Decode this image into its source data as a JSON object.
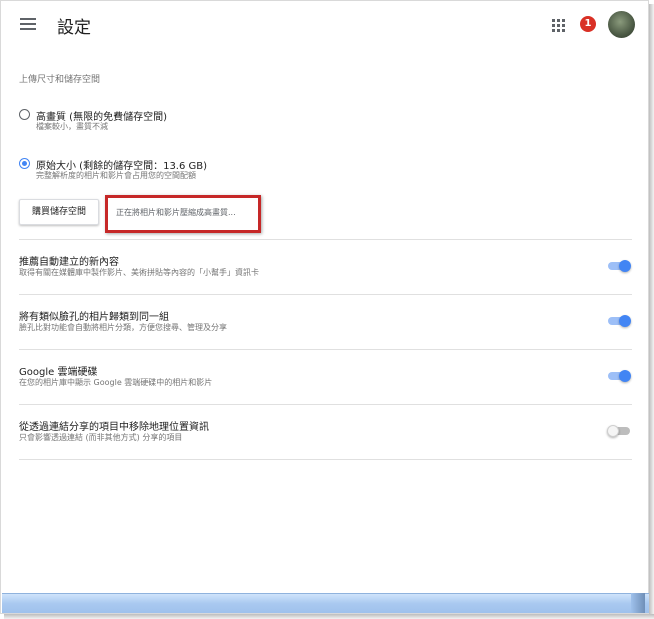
{
  "header": {
    "title": "設定",
    "notification_count": "1"
  },
  "upload": {
    "section_title": "上傳尺寸和儲存空間",
    "options": [
      {
        "label": "高畫質 (無限的免費儲存空間)",
        "sub": "檔案較小，畫質不減",
        "checked": false
      },
      {
        "label": "原始大小 (剩餘的儲存空間：13.6 GB)",
        "sub": "完整解析度的相片和影片會占用您的空間配額",
        "checked": true
      }
    ],
    "buy_button": "購買儲存空間",
    "converting_text": "正在將相片和影片壓縮成高畫質..."
  },
  "settings": [
    {
      "title": "推薦自動建立的新內容",
      "sub": "取得有關在媒體庫中製作影片、美術拼貼等內容的「小幫手」資訊卡",
      "enabled": true
    },
    {
      "title": "將有類似臉孔的相片歸類到同一組",
      "sub": "臉孔比對功能會自動將相片分類，方便您搜尋、管理及分享",
      "enabled": true
    },
    {
      "title": "Google 雲端硬碟",
      "sub": "在您的相片庫中顯示 Google 雲端硬碟中的相片和影片",
      "enabled": true
    },
    {
      "title": "從透過連結分享的項目中移除地理位置資訊",
      "sub": "只會影響透過連結 (而非其他方式) 分享的項目",
      "enabled": false
    }
  ],
  "colors": {
    "accent": "#4285f4",
    "badge": "#d93025",
    "highlight_border": "#c62828"
  },
  "icons": [
    "menu-icon",
    "apps-grid-icon"
  ]
}
